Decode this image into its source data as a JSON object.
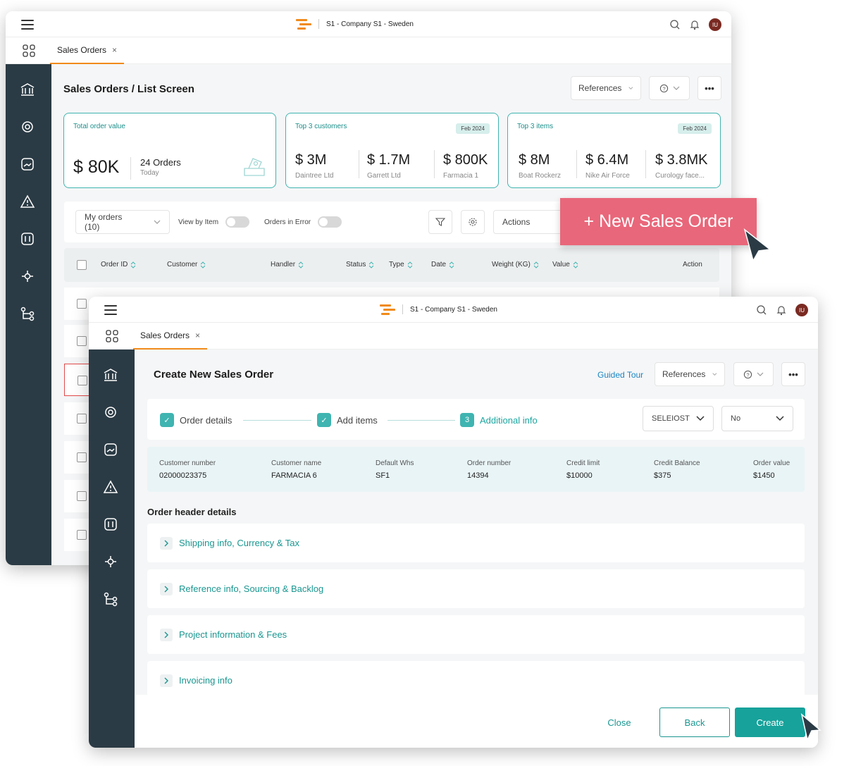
{
  "back_window": {
    "topbar": {
      "company": "S1 - Company S1 - Sweden",
      "avatar_initials": "IU"
    },
    "tab": {
      "label": "Sales Orders",
      "close": "×"
    },
    "page_title": "Sales Orders / List Screen",
    "references_label": "References",
    "more_label": "•••",
    "cards": {
      "total": {
        "label": "Total order value",
        "value": "$ 80K",
        "orders": "24 Orders",
        "when": "Today"
      },
      "customers": {
        "label": "Top 3 customers",
        "badge": "Feb 2024",
        "items": [
          {
            "value": "$ 3M",
            "name": "Daintree Ltd"
          },
          {
            "value": "$ 1.7M",
            "name": "Garrett Ltd"
          },
          {
            "value": "$ 800K",
            "name": "Farmacia 1"
          }
        ]
      },
      "items": {
        "label": "Top 3 items",
        "badge": "Feb 2024",
        "items": [
          {
            "value": "$ 8M",
            "name": "Boat Rockerz"
          },
          {
            "value": "$ 6.4M",
            "name": "Nike Air Force"
          },
          {
            "value": "$ 3.8MK",
            "name": "Curology face..."
          }
        ]
      }
    },
    "filters": {
      "my_orders": "My orders (10)",
      "view_by_item": "View by Item",
      "orders_in_error": "Orders in Error",
      "actions": "Actions"
    },
    "table_headers": [
      "Order ID",
      "Customer",
      "Handler",
      "Status",
      "Type",
      "Date",
      "Weight (KG)",
      "Value",
      "Action"
    ],
    "new_order_button": "+ New Sales Order"
  },
  "front_window": {
    "topbar": {
      "company": "S1 - Company S1 - Sweden",
      "avatar_initials": "IU"
    },
    "tab": {
      "label": "Sales Orders",
      "close": "×"
    },
    "page_title": "Create New Sales Order",
    "guided_tour": "Guided Tour",
    "references_label": "References",
    "more_label": "•••",
    "steps": [
      {
        "label": "Order details",
        "state": "done"
      },
      {
        "label": "Add items",
        "state": "done"
      },
      {
        "label": "Additional info",
        "state": "active",
        "number": "3"
      }
    ],
    "dropdowns": {
      "first": "SELEIOST",
      "second": "No"
    },
    "info": [
      {
        "label": "Customer number",
        "value": "02000023375"
      },
      {
        "label": "Customer name",
        "value": "FARMACIA 6"
      },
      {
        "label": "Default Whs",
        "value": "SF1"
      },
      {
        "label": "Order number",
        "value": "14394"
      },
      {
        "label": "Credit limit",
        "value": "$10000"
      },
      {
        "label": "Credit Balance",
        "value": "$375"
      },
      {
        "label": "Order value",
        "value": "$1450"
      }
    ],
    "section_title": "Order header details",
    "accordions": [
      "Shipping info, Currency & Tax",
      "Reference info, Sourcing & Backlog",
      "Project information & Fees",
      "Invoicing info"
    ],
    "footer": {
      "close": "Close",
      "back": "Back",
      "create": "Create"
    }
  },
  "colors": {
    "accent": "#3fb4b0",
    "brand_orange": "#f08a1a",
    "sidebar": "#2b3b45",
    "new_order": "#e9677a",
    "create": "#17a29b"
  }
}
